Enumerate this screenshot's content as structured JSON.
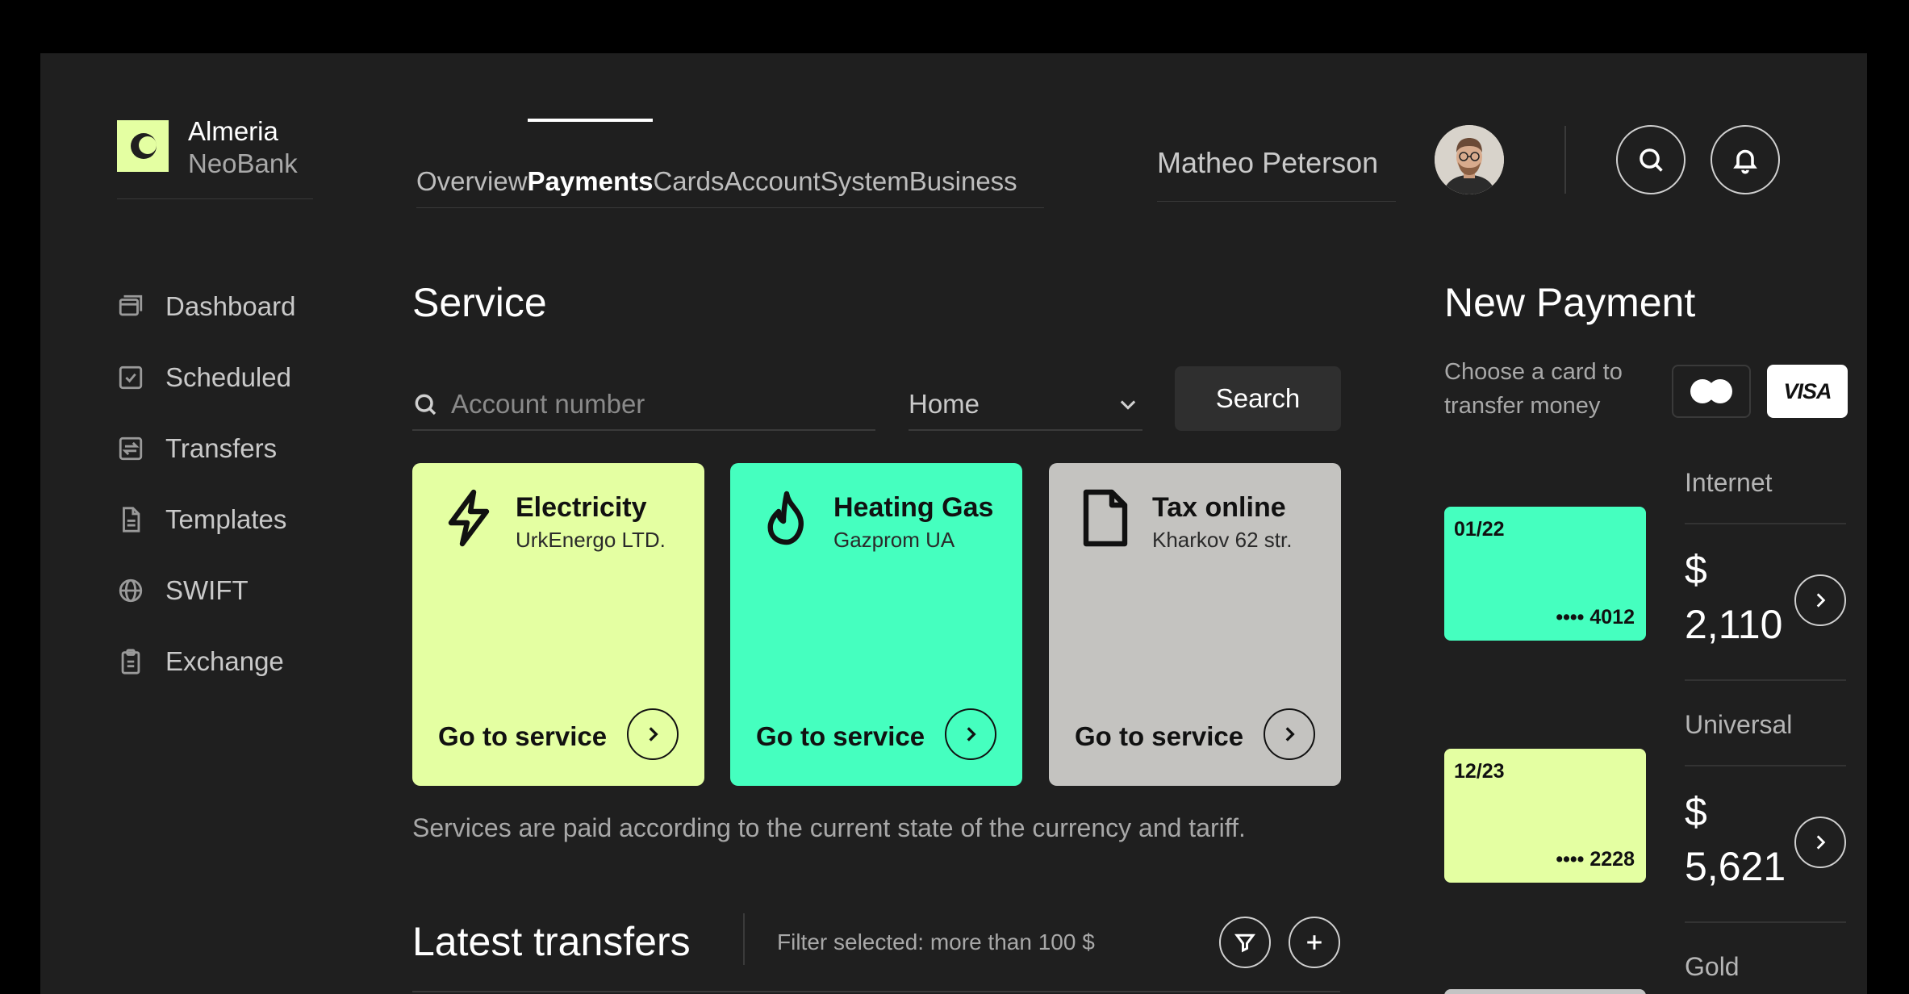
{
  "brand": {
    "line1": "Almeria",
    "line2": "NeoBank",
    "accent": "#e4ffa2"
  },
  "sidebar": {
    "items": [
      {
        "label": "Dashboard",
        "icon": "window-icon"
      },
      {
        "label": "Scheduled",
        "icon": "checkbox-icon"
      },
      {
        "label": "Transfers",
        "icon": "transfer-icon"
      },
      {
        "label": "Templates",
        "icon": "document-icon"
      },
      {
        "label": "SWIFT",
        "icon": "globe-icon"
      },
      {
        "label": "Exchange",
        "icon": "clipboard-icon"
      }
    ]
  },
  "nav": {
    "tabs": [
      "Overview",
      "Payments",
      "Cards",
      "Account",
      "System",
      "Business"
    ],
    "active": "Payments"
  },
  "user": {
    "name": "Matheo Peterson"
  },
  "service": {
    "title": "Service",
    "search_placeholder": "Account number",
    "category": "Home",
    "search_button": "Search",
    "cards": [
      {
        "name": "Electricity",
        "provider": "UrkEnergo LTD.",
        "action": "Go to service",
        "color": "#e4ffa2",
        "icon": "lightning-icon"
      },
      {
        "name": "Heating Gas",
        "provider": "Gazprom UA",
        "action": "Go to service",
        "color": "#45ffbf",
        "icon": "flame-icon"
      },
      {
        "name": "Tax online",
        "provider": "Kharkov 62 str.",
        "action": "Go to service",
        "color": "#c4c3c0",
        "icon": "file-icon"
      }
    ],
    "note": "Services are paid according to the current state of the currency and tariff."
  },
  "latest": {
    "title": "Latest transfers",
    "filter": "Filter selected: more than 100 $"
  },
  "new_payment": {
    "title": "New Payment",
    "subtitle": "Choose a card to transfer money",
    "visa_label": "VISA",
    "cards": [
      {
        "expiry": "01/22",
        "number": "•••• 4012",
        "color": "#45ffbf"
      },
      {
        "expiry": "12/23",
        "number": "•••• 2228",
        "color": "#e4ffa2"
      }
    ],
    "accounts": [
      {
        "name": "Internet",
        "amount": "$ 2,110"
      },
      {
        "name": "Universal",
        "amount": "$ 5,621"
      },
      {
        "name": "Gold"
      }
    ]
  }
}
